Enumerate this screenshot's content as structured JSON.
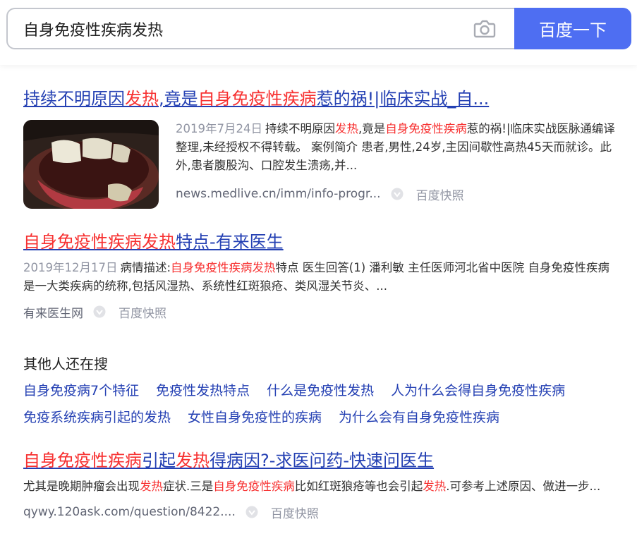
{
  "search": {
    "query": "自身免疫性疾病发热",
    "button_label": "百度一下"
  },
  "results": [
    {
      "title_parts": [
        {
          "text": "持续不明原因",
          "hl": false
        },
        {
          "text": "发热",
          "hl": true
        },
        {
          "text": ",竟是",
          "hl": false
        },
        {
          "text": "自身免疫性疾病",
          "hl": true
        },
        {
          "text": "惹的祸!|临床实战_自...",
          "hl": false
        }
      ],
      "date": "2019年7月24日",
      "snippet_parts": [
        {
          "text": "持续不明原因",
          "hl": false
        },
        {
          "text": "发热",
          "hl": true
        },
        {
          "text": ",竟是",
          "hl": false
        },
        {
          "text": "自身免疫性疾病",
          "hl": true
        },
        {
          "text": "惹的祸!|临床实战医脉通编译整理,未经授权不得转载。 案例简介 患者,男性,24岁,主因间歇性高热45天而就诊。此外,患者腹股沟、口腔发生溃疡,并...",
          "hl": false
        }
      ],
      "source": "news.medlive.cn/imm/info-progr...",
      "cache_label": "百度快照"
    },
    {
      "title_parts": [
        {
          "text": "自身免疫性疾病发热",
          "hl": true
        },
        {
          "text": "特点-有来医生",
          "hl": false
        }
      ],
      "date": "2019年12月17日",
      "snippet_parts": [
        {
          "text": "病情描述:",
          "hl": false
        },
        {
          "text": "自身免疫性疾病发热",
          "hl": true
        },
        {
          "text": "特点 医生回答(1) 潘利敏 主任医师河北省中医院 自身免疫性疾病是一大类疾病的统称,包括风湿热、系统性红斑狼疮、类风湿关节炎、...",
          "hl": false
        }
      ],
      "source": "有来医生网",
      "cache_label": "百度快照"
    },
    {
      "title_parts": [
        {
          "text": "自身免疫性疾病",
          "hl": true
        },
        {
          "text": "引起",
          "hl": false
        },
        {
          "text": "发热",
          "hl": true
        },
        {
          "text": "得病因?-求医问药-快速问医生",
          "hl": false
        }
      ],
      "date": "",
      "snippet_parts": [
        {
          "text": "尤其是晚期肿瘤会出现",
          "hl": false
        },
        {
          "text": "发热",
          "hl": true
        },
        {
          "text": "症状.三是",
          "hl": false
        },
        {
          "text": "自身免疫性疾病",
          "hl": true
        },
        {
          "text": "比如红斑狼疮等也会引起",
          "hl": false
        },
        {
          "text": "发热",
          "hl": true
        },
        {
          "text": ".可参考上述原因、做进一步...",
          "hl": false
        }
      ],
      "source": "qywy.120ask.com/question/8422....",
      "cache_label": "百度快照"
    }
  ],
  "related": {
    "heading": "其他人还在搜",
    "rows": [
      [
        "自身免疫病7个特征",
        "免疫性发热特点",
        "什么是免疫性发热",
        "人为什么会得自身免疫性疾病"
      ],
      [
        "免疫系统疾病引起的发热",
        "女性自身免疫性的疾病",
        "为什么会有自身免疫性疾病"
      ]
    ]
  },
  "colors": {
    "link": "#2440b3",
    "highlight": "#f73131",
    "button": "#4e6ef2"
  }
}
